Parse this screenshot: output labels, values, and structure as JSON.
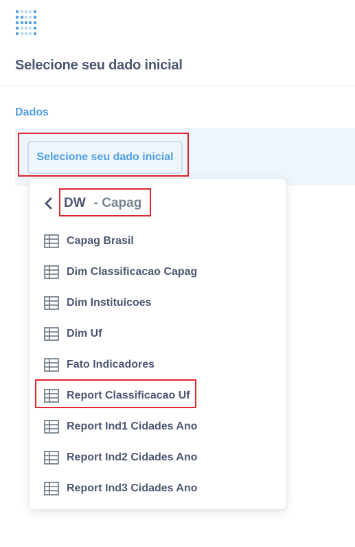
{
  "header": {
    "title": "Selecione seu dado inicial",
    "logo_icon": "metabase-logo-icon"
  },
  "data_section": {
    "label": "Dados",
    "picker_button_label": "Selecione seu dado inicial"
  },
  "picker": {
    "back_icon": "chevron-left-icon",
    "database": "DW",
    "schema": "- Capag",
    "table_icon": "table-icon",
    "tables": [
      {
        "label": "Capag Brasil"
      },
      {
        "label": "Dim Classificacao Capag"
      },
      {
        "label": "Dim Instituicoes"
      },
      {
        "label": "Dim Uf"
      },
      {
        "label": "Fato Indicadores"
      },
      {
        "label": "Report Classificacao Uf"
      },
      {
        "label": "Report Ind1 Cidades Ano"
      },
      {
        "label": "Report Ind2 Cidades Ano"
      },
      {
        "label": "Report Ind3 Cidades Ano"
      }
    ]
  },
  "colors": {
    "brand": "#509ee3",
    "text_dark": "#4c5773",
    "text_medium": "#74838f",
    "highlight_border": "#e0232d",
    "step_background": "#eef6fc"
  }
}
